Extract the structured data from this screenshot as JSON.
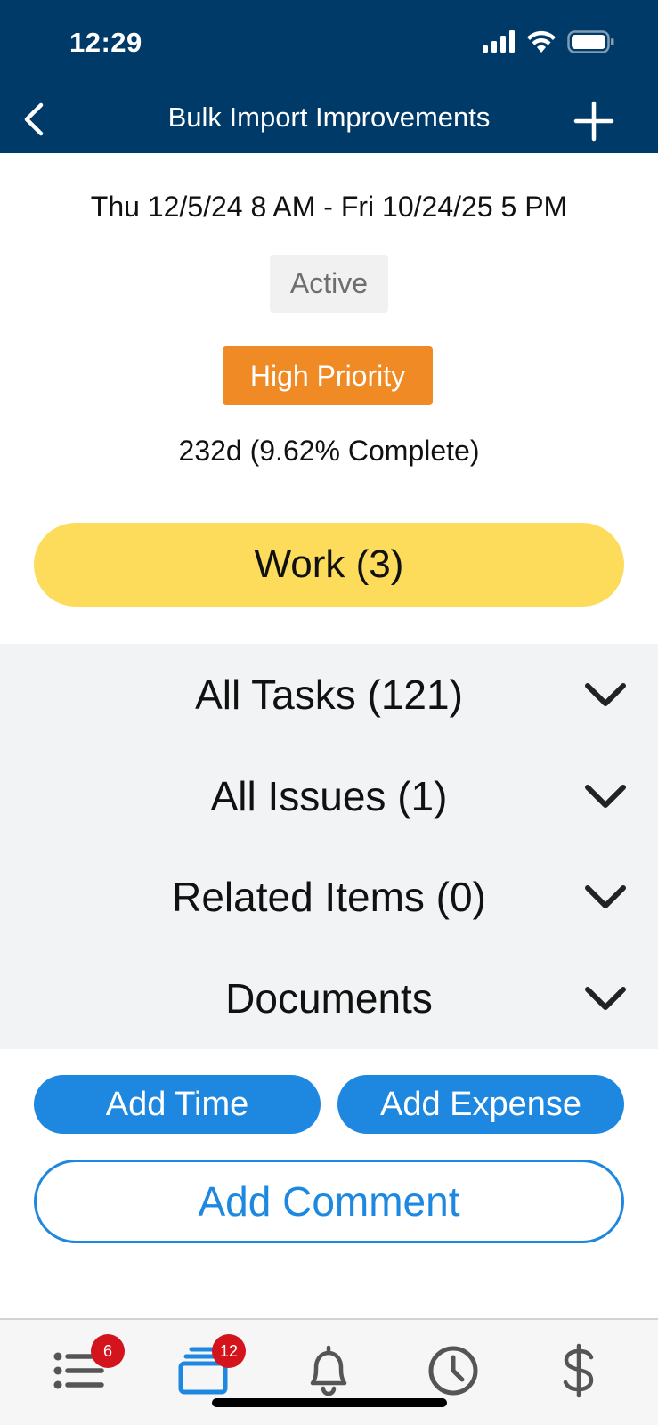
{
  "status_bar": {
    "time": "12:29"
  },
  "nav": {
    "title": "Bulk Import Improvements"
  },
  "project": {
    "date_range": "Thu 12/5/24 8 AM - Fri 10/24/25 5 PM",
    "status": "Active",
    "priority": "High Priority",
    "progress": "232d (9.62% Complete)",
    "work_label": "Work (3)"
  },
  "sections": [
    {
      "label": "All Tasks (121)"
    },
    {
      "label": "All Issues (1)"
    },
    {
      "label": "Related Items (0)"
    },
    {
      "label": "Documents"
    }
  ],
  "actions": {
    "add_time": "Add Time",
    "add_expense": "Add Expense",
    "add_comment": "Add Comment"
  },
  "tabs": {
    "list_badge": "6",
    "cards_badge": "12"
  },
  "icons": [
    "back-chevron-icon",
    "plus-icon",
    "chevron-down-icon",
    "list-icon",
    "cards-icon",
    "bell-icon",
    "clock-icon",
    "dollar-icon"
  ],
  "colors": {
    "header": "#003a69",
    "work_button": "#fddc5c",
    "priority": "#f08a24",
    "primary": "#1e88e0",
    "badge": "#d4141c",
    "section_bg": "#f2f3f5"
  }
}
